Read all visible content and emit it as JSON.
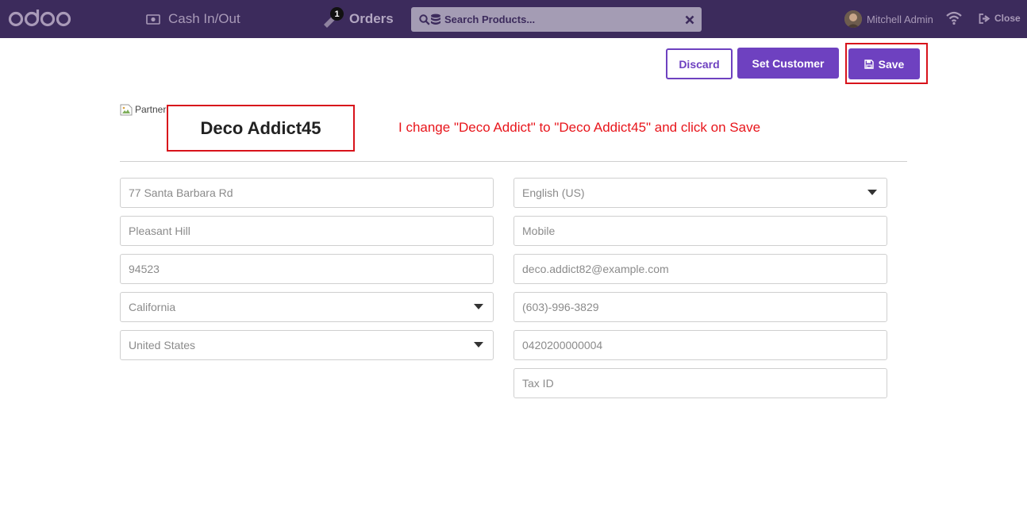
{
  "topbar": {
    "logo_text": "odoo",
    "cash_label": "Cash In/Out",
    "orders_label": "Orders",
    "orders_count": "1",
    "search_placeholder": "Search Products...",
    "user_name": "Mitchell Admin",
    "close_label": "Close"
  },
  "actions": {
    "discard_label": "Discard",
    "set_customer_label": "Set Customer",
    "save_label": "Save"
  },
  "partner": {
    "image_alt": "Partner",
    "name": "Deco Addict45",
    "annotation": "I change \"Deco Addict\" to \"Deco Addict45\" and click on Save"
  },
  "form": {
    "street": "77 Santa Barbara Rd",
    "city": "Pleasant Hill",
    "zip": "94523",
    "state": "California",
    "country": "United States",
    "language": "English (US)",
    "mobile_placeholder": "Mobile",
    "email": "deco.addict82@example.com",
    "phone": "(603)-996-3829",
    "barcode": "0420200000004",
    "tax_placeholder": "Tax ID"
  },
  "colors": {
    "topbar": "#3c2b5c",
    "primary": "#6e41c0",
    "highlight": "#d8131b"
  }
}
